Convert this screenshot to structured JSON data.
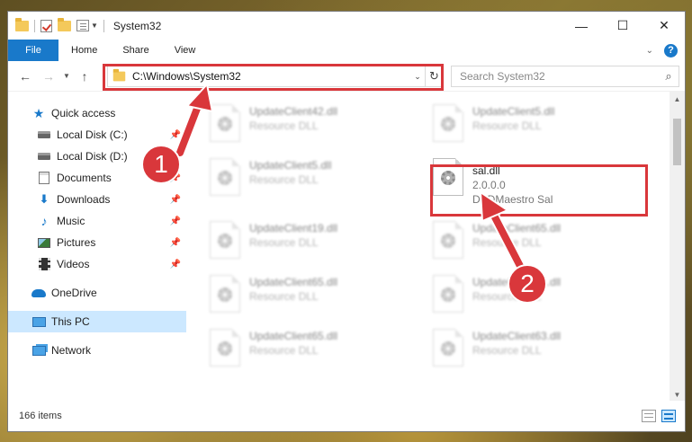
{
  "window": {
    "title": "System32",
    "minimize_glyph": "—",
    "maximize_glyph": "☐",
    "close_glyph": "✕"
  },
  "ribbon": {
    "tabs": [
      {
        "label": "File"
      },
      {
        "label": "Home"
      },
      {
        "label": "Share"
      },
      {
        "label": "View"
      }
    ],
    "help_glyph": "?"
  },
  "nav": {
    "address": "C:\\Windows\\System32",
    "search_placeholder": "Search System32"
  },
  "sidebar": {
    "items": [
      {
        "label": "Quick access",
        "icon": "star-icon",
        "pinned": false
      },
      {
        "label": "Local Disk (C:)",
        "icon": "disk-icon",
        "pinned": true
      },
      {
        "label": "Local Disk (D:)",
        "icon": "disk-icon",
        "pinned": true
      },
      {
        "label": "Documents",
        "icon": "documents-icon",
        "pinned": true
      },
      {
        "label": "Downloads",
        "icon": "downloads-icon",
        "pinned": true
      },
      {
        "label": "Music",
        "icon": "music-icon",
        "pinned": true
      },
      {
        "label": "Pictures",
        "icon": "pictures-icon",
        "pinned": true
      },
      {
        "label": "Videos",
        "icon": "videos-icon",
        "pinned": true
      },
      {
        "label": "OneDrive",
        "icon": "onedrive-icon",
        "pinned": false
      },
      {
        "label": "This PC",
        "icon": "this-pc-icon",
        "pinned": false,
        "selected": true
      },
      {
        "label": "Network",
        "icon": "network-icon",
        "pinned": false
      }
    ]
  },
  "files": [
    {
      "name": "UpdateClient42.dll",
      "sub": "Resource DLL"
    },
    {
      "name": "UpdateClient5.dll",
      "sub": "Resource DLL"
    },
    {
      "name": "UpdateClient5.dll",
      "sub": "Resource DLL"
    },
    {
      "name": "sal.dll",
      "version": "2.0.0.0",
      "desc": "DVDMaestro Sal",
      "highlighted": true
    },
    {
      "name": "UpdateClient19.dll",
      "sub": "Resource DLL"
    },
    {
      "name": "UpdateClient65.dll",
      "sub": "Resource DLL"
    },
    {
      "name": "UpdateClient65.dll",
      "sub": "Resource DLL"
    },
    {
      "name": "UpdateClient21.dll",
      "sub": "Resource DLL"
    },
    {
      "name": "UpdateClient65.dll",
      "sub": "Resource DLL"
    },
    {
      "name": "UpdateClient63.dll",
      "sub": "Resource DLL"
    }
  ],
  "status": {
    "item_count": "166 items"
  },
  "callouts": [
    {
      "number": "1"
    },
    {
      "number": "2"
    }
  ],
  "colors": {
    "accent": "#1979ca",
    "callout_red": "#d9373b",
    "selection": "#cce8ff"
  }
}
